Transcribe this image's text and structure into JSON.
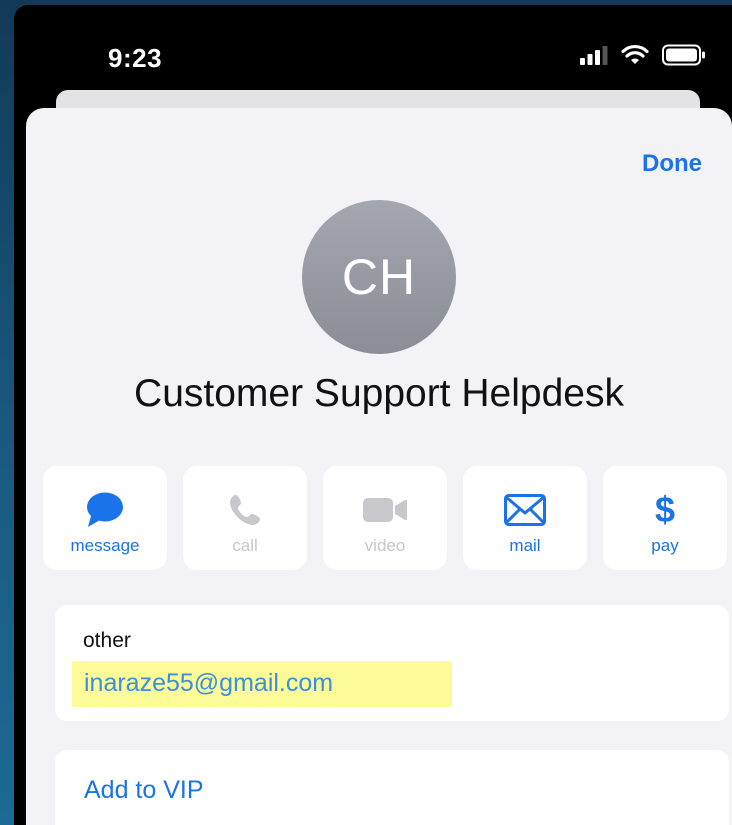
{
  "status_bar": {
    "time": "9:23",
    "icons": [
      "signal-icon",
      "wifi-icon",
      "battery-icon"
    ]
  },
  "header": {
    "done_label": "Done"
  },
  "contact": {
    "initials": "CH",
    "name": "Customer Support Helpdesk"
  },
  "actions": [
    {
      "label": "message",
      "icon": "message-icon",
      "enabled": true
    },
    {
      "label": "call",
      "icon": "phone-icon",
      "enabled": false
    },
    {
      "label": "video",
      "icon": "video-icon",
      "enabled": false
    },
    {
      "label": "mail",
      "icon": "mail-icon",
      "enabled": true
    },
    {
      "label": "pay",
      "icon": "dollar-icon",
      "enabled": true
    }
  ],
  "email": {
    "label": "other",
    "value": "inaraze55@gmail.com",
    "highlight_color": "#fcfb97"
  },
  "vip": {
    "label": "Add to VIP"
  },
  "colors": {
    "accent": "#1a73e8",
    "disabled": "#c7c7cc"
  }
}
